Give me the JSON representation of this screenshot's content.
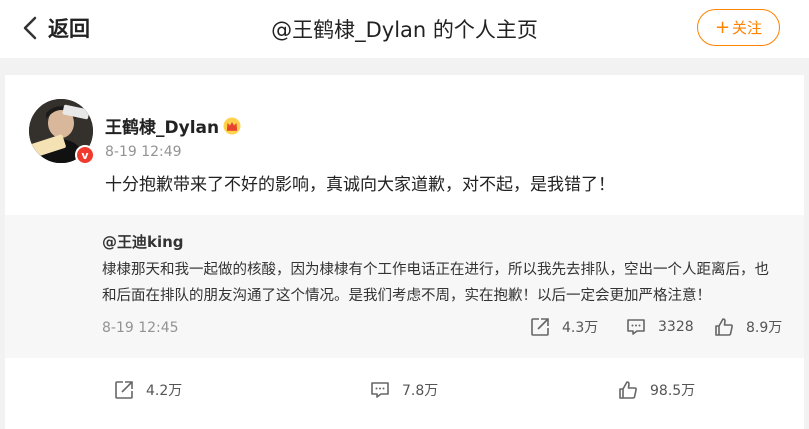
{
  "header": {
    "back_label": "返回",
    "title": "@王鹤棣_Dylan 的个人主页",
    "follow_label": "关注"
  },
  "post": {
    "author": "王鹤棣_Dylan",
    "time": "8-19 12:49",
    "text": "十分抱歉带来了不好的影响，真诚向大家道歉，对不起，是我错了！",
    "verified_badge": "v",
    "repost_count": "4.2万",
    "comment_count": "7.8万",
    "like_count": "98.5万"
  },
  "quoted": {
    "author": "@王迪king",
    "text": "棣棣那天和我一起做的核酸，因为棣棣有个工作电话正在进行，所以我先去排队，空出一个人距离后，也和后面在排队的朋友沟通了这个情况。是我们考虑不周，实在抱歉！以后一定会更加严格注意！",
    "time": "8-19 12:45",
    "repost_count": "4.3万",
    "comment_count": "3328",
    "like_count": "8.9万"
  },
  "colors": {
    "accent": "#ff8200",
    "badge_red": "#f03a2e",
    "muted": "#939393"
  },
  "icons": [
    "chevron-left-icon",
    "plus-icon",
    "crown-icon",
    "repost-icon",
    "comment-icon",
    "like-icon"
  ]
}
